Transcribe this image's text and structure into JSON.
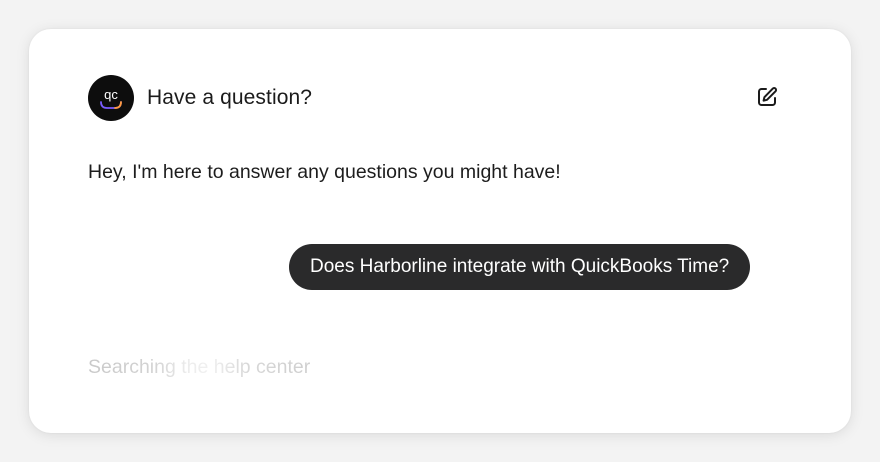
{
  "header": {
    "avatar_text": "qc",
    "title": "Have a question?",
    "edit_icon": "edit-icon"
  },
  "messages": {
    "greeting": "Hey, I'm here to answer any questions you might have!",
    "user_question": "Does Harborline integrate with QuickBooks Time?"
  },
  "status": {
    "text": "Searching the help center"
  },
  "colors": {
    "avatar_bg": "#0d0d0d",
    "bubble_bg": "#2a2a2b",
    "bubble_text": "#ffffff",
    "status_text": "#cfcfcf"
  }
}
